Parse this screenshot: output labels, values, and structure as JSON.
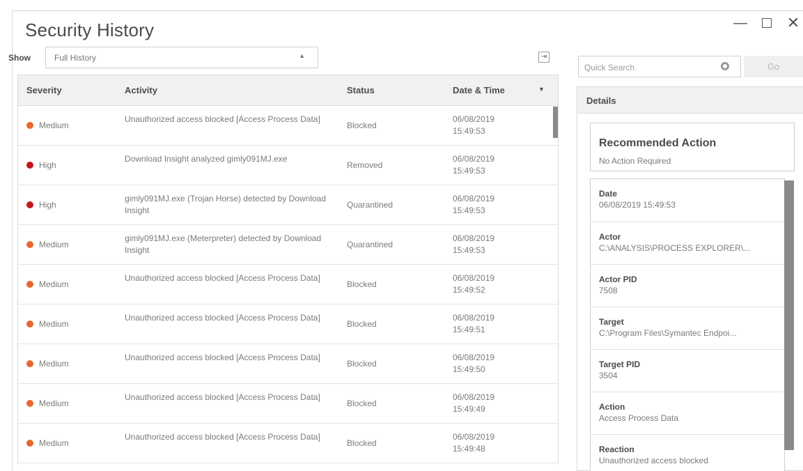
{
  "window": {
    "title": "Security History",
    "minimize_glyph": "—",
    "close_glyph": "✕"
  },
  "filter": {
    "show_label": "Show",
    "selected": "Full History",
    "caret": "▲"
  },
  "table": {
    "columns": {
      "severity": "Severity",
      "activity": "Activity",
      "status": "Status",
      "datetime": "Date & Time",
      "sort_glyph": "▼"
    },
    "rows": [
      {
        "severity": "Medium",
        "color": "#e8672c",
        "activity": "Unauthorized access blocked [Access Process Data]",
        "status": "Blocked",
        "date": "06/08/2019",
        "time": "15:49:53"
      },
      {
        "severity": "High",
        "color": "#c3161c",
        "activity": "Download Insight analyzed gimly091MJ.exe",
        "status": "Removed",
        "date": "06/08/2019",
        "time": "15:49:53"
      },
      {
        "severity": "High",
        "color": "#c3161c",
        "activity": "gimly091MJ.exe (Trojan Horse) detected by Download Insight",
        "status": "Quarantined",
        "date": "06/08/2019",
        "time": "15:49:53"
      },
      {
        "severity": "Medium",
        "color": "#e8672c",
        "activity": "gimly091MJ.exe (Meterpreter) detected by Download Insight",
        "status": "Quarantined",
        "date": "06/08/2019",
        "time": "15:49:53"
      },
      {
        "severity": "Medium",
        "color": "#e8672c",
        "activity": "Unauthorized access blocked [Access Process Data]",
        "status": "Blocked",
        "date": "06/08/2019",
        "time": "15:49:52"
      },
      {
        "severity": "Medium",
        "color": "#e8672c",
        "activity": "Unauthorized access blocked [Access Process Data]",
        "status": "Blocked",
        "date": "06/08/2019",
        "time": "15:49:51"
      },
      {
        "severity": "Medium",
        "color": "#e8672c",
        "activity": "Unauthorized access blocked [Access Process Data]",
        "status": "Blocked",
        "date": "06/08/2019",
        "time": "15:49:50"
      },
      {
        "severity": "Medium",
        "color": "#e8672c",
        "activity": "Unauthorized access blocked [Access Process Data]",
        "status": "Blocked",
        "date": "06/08/2019",
        "time": "15:49:49"
      },
      {
        "severity": "Medium",
        "color": "#e8672c",
        "activity": "Unauthorized access blocked [Access Process Data]",
        "status": "Blocked",
        "date": "06/08/2019",
        "time": "15:49:48"
      }
    ]
  },
  "search": {
    "placeholder": "Quick Search",
    "go_label": "Go"
  },
  "details": {
    "header": "Details",
    "recommended_title": "Recommended Action",
    "recommended_value": "No Action Required",
    "fields": [
      {
        "label": "Date",
        "value": "06/08/2019 15:49:53"
      },
      {
        "label": "Actor",
        "value": "C:\\ANALYSIS\\PROCESS EXPLORER\\..."
      },
      {
        "label": "Actor PID",
        "value": "7508"
      },
      {
        "label": "Target",
        "value": "C:\\Program Files\\Symantec Endpoi..."
      },
      {
        "label": "Target PID",
        "value": "3504"
      },
      {
        "label": "Action",
        "value": "Access Process Data"
      },
      {
        "label": "Reaction",
        "value": "Unauthorized access blocked"
      }
    ]
  }
}
